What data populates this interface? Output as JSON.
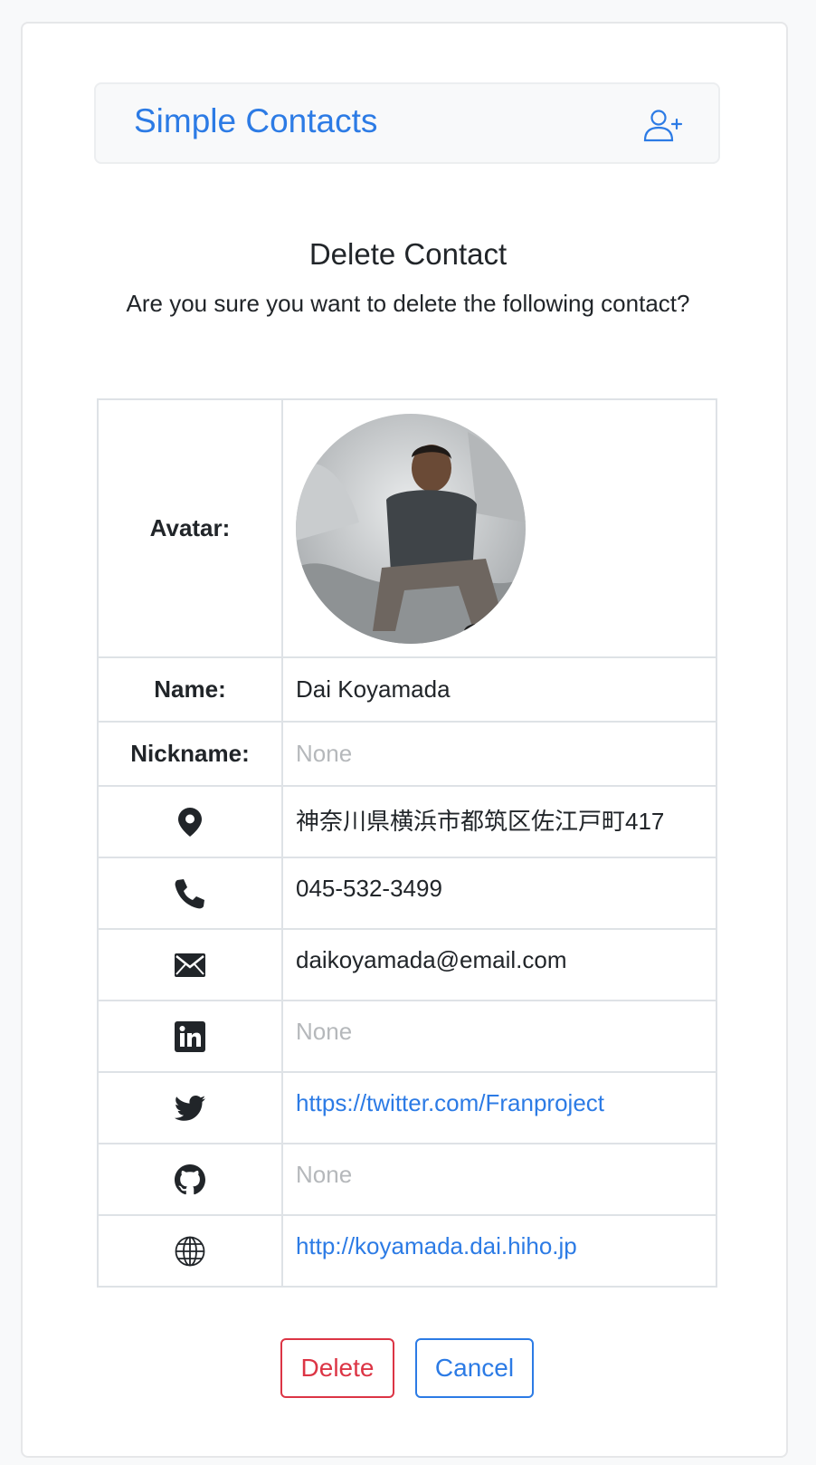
{
  "navbar": {
    "brand": "Simple Contacts",
    "add_icon": "person-plus-icon"
  },
  "page": {
    "title": "Delete Contact",
    "subtitle": "Are you sure you want to delete the following contact?"
  },
  "contact": {
    "avatar_label": "Avatar:",
    "name_label": "Name:",
    "name": "Dai Koyamada",
    "nickname_label": "Nickname:",
    "nickname": "None",
    "address_icon": "map-pin-icon",
    "address": "神奈川県横浜市都筑区佐江戸町417",
    "phone_icon": "phone-icon",
    "phone": "045-532-3499",
    "email_icon": "envelope-icon",
    "email": "daikoyamada@email.com",
    "linkedin_icon": "linkedin-icon",
    "linkedin": "None",
    "twitter_icon": "twitter-icon",
    "twitter": "https://twitter.com/Franproject",
    "github_icon": "github-icon",
    "github": "None",
    "website_icon": "globe-icon",
    "website": "http://koyamada.dai.hiho.jp"
  },
  "actions": {
    "delete_label": "Delete",
    "cancel_label": "Cancel"
  },
  "colors": {
    "primary": "#2c7be5",
    "danger": "#dc3545",
    "muted": "#b5b8bb"
  }
}
